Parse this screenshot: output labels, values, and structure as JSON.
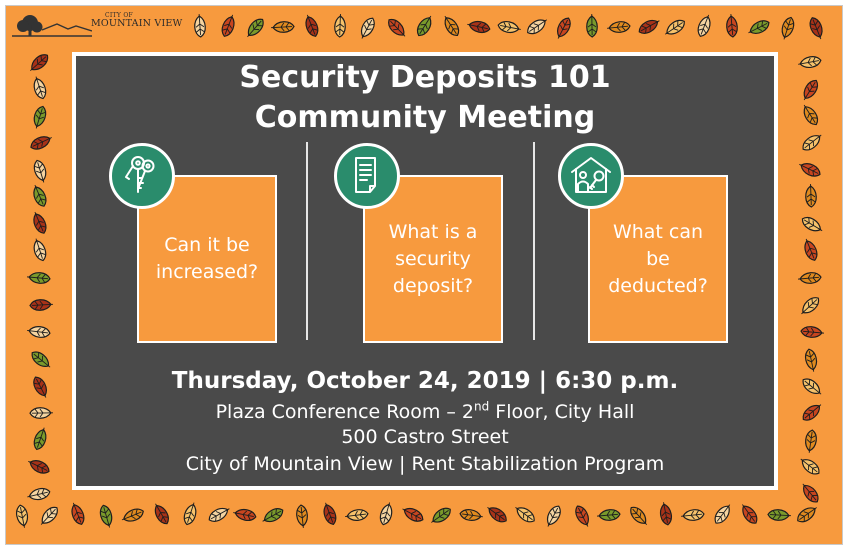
{
  "logo": {
    "line1": "CITY OF",
    "line2": "MOUNTAIN VIEW"
  },
  "title": {
    "line1": "Security Deposits 101",
    "line2": "Community Meeting"
  },
  "cards": [
    {
      "icon": "keys-icon",
      "text": "Can it be increased?"
    },
    {
      "icon": "document-icon",
      "text": "What is a security deposit?"
    },
    {
      "icon": "house-person-key-icon",
      "text": "What can be deducted?"
    }
  ],
  "event": {
    "date_time": "Thursday, October 24, 2019 | 6:30 p.m.",
    "location_before": "Plaza Conference Room – 2",
    "location_sup": "nd",
    "location_after": " Floor, City Hall",
    "address": "500 Castro Street",
    "organizer": "City of Mountain View | Rent Stabilization Program"
  },
  "colors": {
    "orange": "#f79a3e",
    "panel": "#4a4a4a",
    "icon_green": "#2a8c6c",
    "white": "#ffffff"
  }
}
